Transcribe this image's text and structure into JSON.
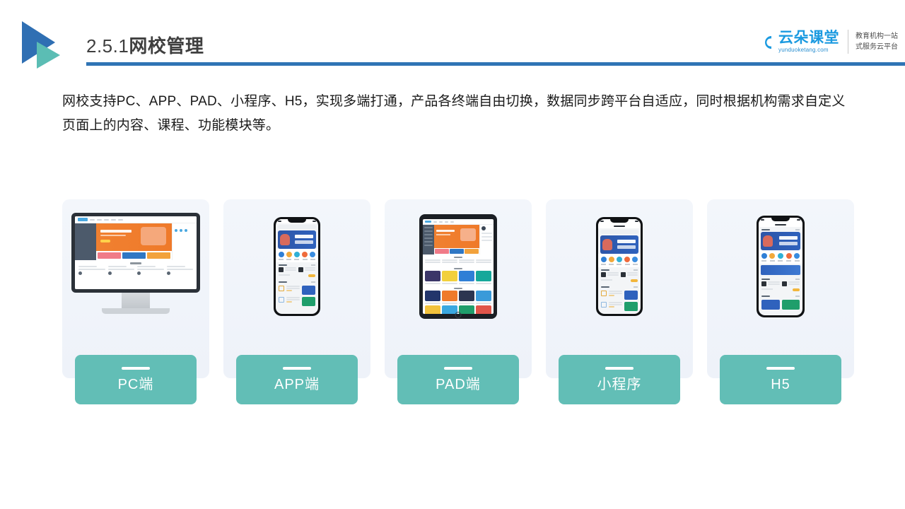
{
  "header": {
    "title_number": "2.5.1",
    "title_name": "网校管理",
    "logo_icon": "double-triangle-logo",
    "rule_color": "#2f74b5"
  },
  "brand": {
    "icon": "cloud-icon",
    "name_cn": "云朵课堂",
    "domain": "yunduoketang.com",
    "tagline_line1": "教育机构一站",
    "tagline_line2": "式服务云平台",
    "accent_color": "#1b9ae0"
  },
  "intro": {
    "text": "网校支持PC、APP、PAD、小程序、H5，实现多端打通，产品各终端自由切换，数据同步跨平台自适应，同时根据机构需求自定义页面上的内容、课程、功能模块等。"
  },
  "cards": {
    "label_color": "#62beb6",
    "background_color": "#f2f5fb",
    "items": [
      {
        "label": "PC端",
        "device": "desktop-monitor"
      },
      {
        "label": "APP端",
        "device": "smartphone"
      },
      {
        "label": "PAD端",
        "device": "tablet"
      },
      {
        "label": "小程序",
        "device": "smartphone"
      },
      {
        "label": "H5",
        "device": "smartphone"
      }
    ]
  }
}
